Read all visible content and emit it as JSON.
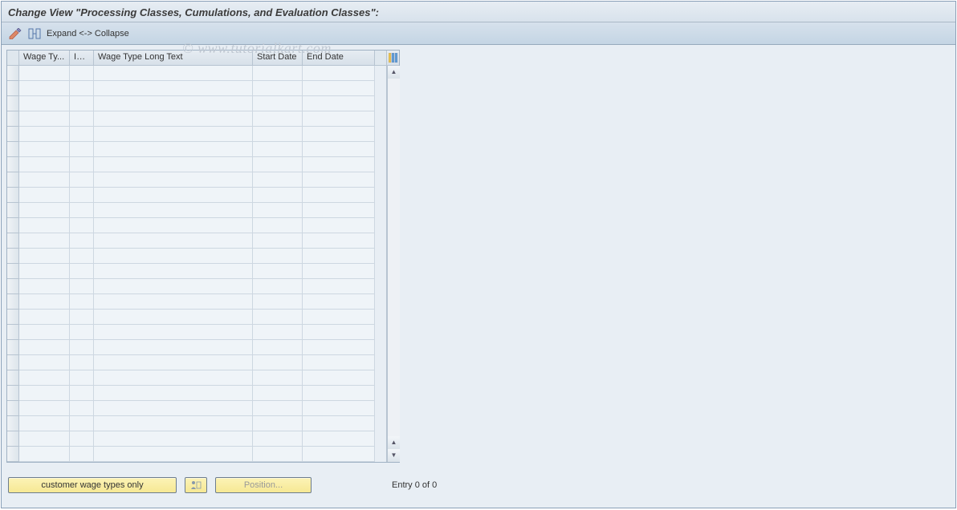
{
  "title": "Change View \"Processing Classes, Cumulations, and Evaluation Classes\":",
  "watermark": "© www.tutorialkart.com",
  "toolbar": {
    "expand_collapse": "Expand <-> Collapse"
  },
  "grid": {
    "headers": {
      "wage_type": "Wage Ty...",
      "inf": "Inf...",
      "long_text": "Wage Type Long Text",
      "start_date": "Start Date",
      "end_date": "End Date"
    },
    "row_count": 26
  },
  "footer": {
    "customer_button": "customer wage types only",
    "position_button": "Position...",
    "entry_text": "Entry 0 of 0"
  }
}
